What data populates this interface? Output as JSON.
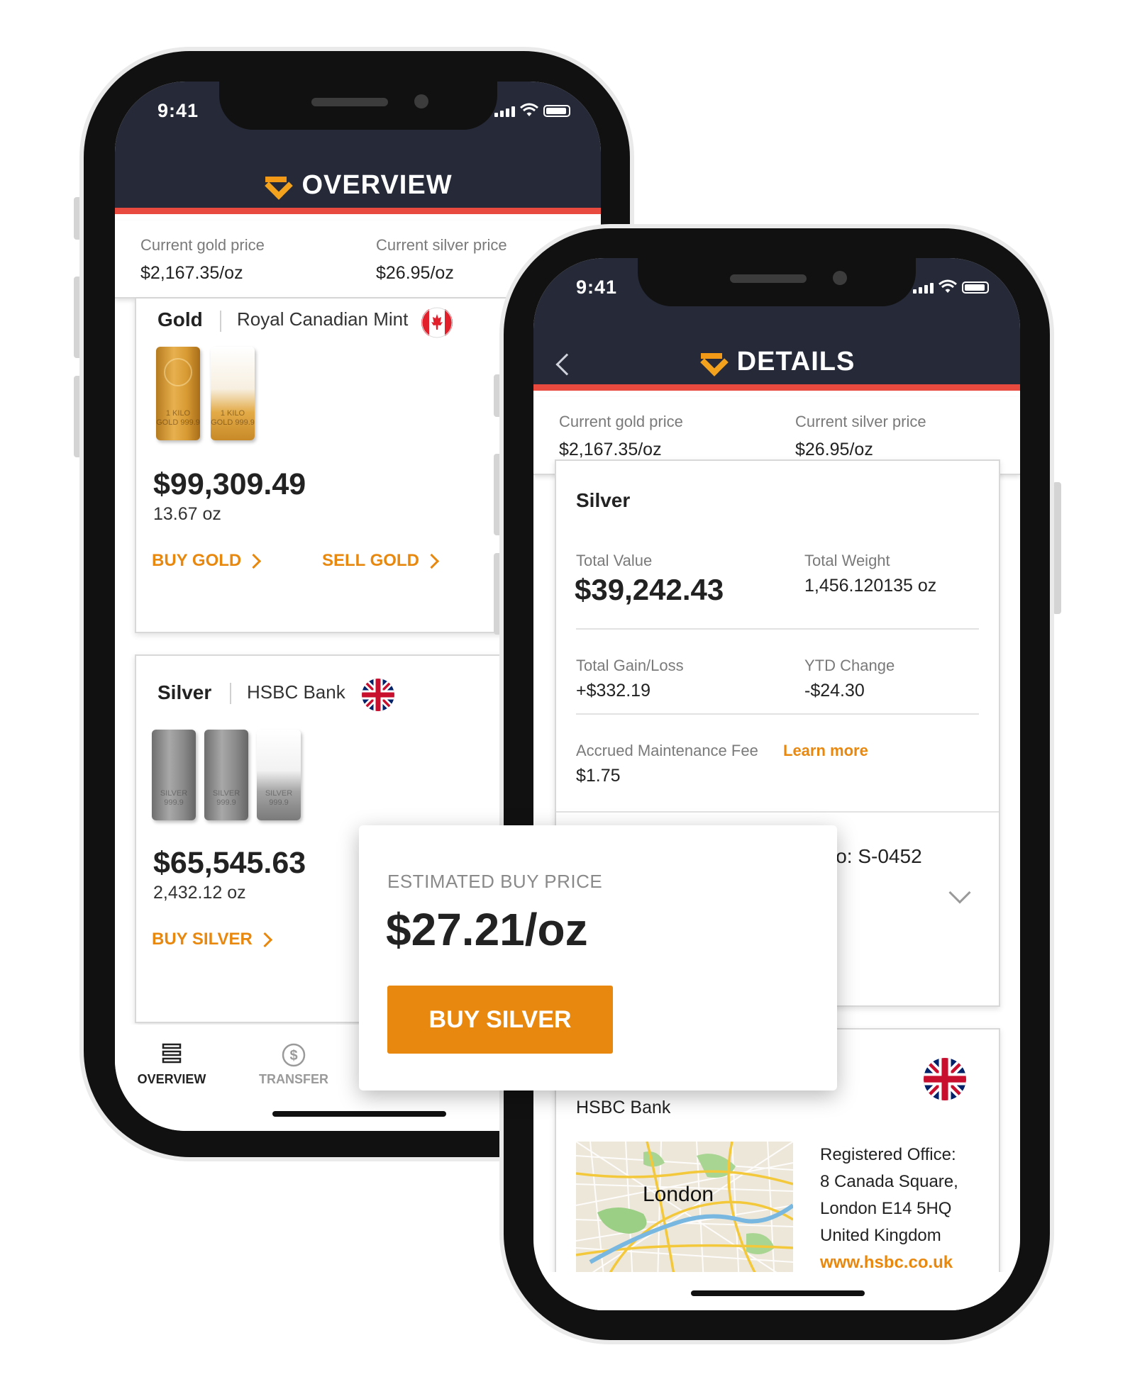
{
  "colors": {
    "header": "#262a38",
    "accent_red": "#e84a3f",
    "orange": "#e8880f"
  },
  "overview_screen": {
    "time": "9:41",
    "title": "OVERVIEW",
    "logo_icon": "chevron-v-logo",
    "gold_price_label": "Current gold price",
    "gold_price": "$2,167.35/oz",
    "silver_price_label": "Current silver price",
    "silver_price": "$26.95/oz",
    "gold_card": {
      "metal": "Gold",
      "provider": "Royal Canadian Mint",
      "flag": "canada-flag",
      "bar_text": "1 KILO GOLD 999.9",
      "amount": "$99,309.49",
      "weight": "13.67 oz",
      "buy_label": "BUY GOLD",
      "sell_label": "SELL GOLD"
    },
    "silver_card": {
      "metal": "Silver",
      "provider": "HSBC Bank",
      "flag": "uk-flag",
      "bar_text": "SILVER 999.9",
      "amount": "$65,545.63",
      "weight": "2,432.12 oz",
      "buy_label": "BUY SILVER"
    },
    "tabs": [
      {
        "label": "OVERVIEW",
        "icon": "list-icon",
        "active": true
      },
      {
        "label": "TRANSFER",
        "icon": "dollar-circle-icon",
        "active": false
      }
    ]
  },
  "details_screen": {
    "time": "9:41",
    "title": "DETAILS",
    "gold_price_label": "Current gold price",
    "gold_price": "$2,167.35/oz",
    "silver_price_label": "Current silver price",
    "silver_price": "$26.95/oz",
    "card": {
      "metal": "Silver",
      "total_value_label": "Total Value",
      "total_value": "$39,242.43",
      "total_weight_label": "Total Weight",
      "total_weight": "1,456.120135 oz",
      "gain_loss_label": "Total Gain/Loss",
      "gain_loss": "+$332.19",
      "ytd_label": "YTD Change",
      "ytd": "-$24.30",
      "fee_label": "Accrued Maintenance Fee",
      "fee_link": "Learn more",
      "fee": "$1.75",
      "serial_partial": "l No: S-0452"
    },
    "bank_card": {
      "name": "HSBC Bank",
      "flag": "uk-flag",
      "map_label": "London",
      "office_lines": [
        "Registered Office:",
        "8 Canada Square,",
        "London E14 5HQ",
        "United Kingdom"
      ],
      "website": "www.hsbc.co.uk"
    }
  },
  "popup": {
    "label": "ESTIMATED BUY PRICE",
    "price": "$27.21/oz",
    "button": "BUY SILVER"
  }
}
